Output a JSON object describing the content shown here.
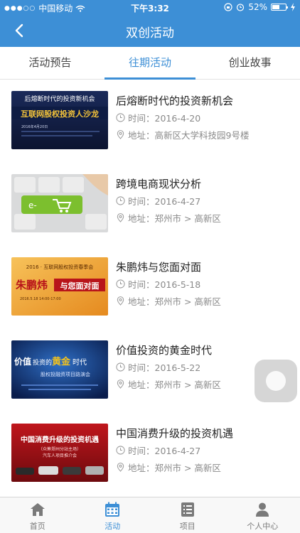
{
  "status_bar": {
    "carrier": "中国移动",
    "time": "下午3:32",
    "battery": "52%"
  },
  "nav": {
    "title": "双创活动"
  },
  "tabs": [
    {
      "label": "活动预告"
    },
    {
      "label": "往期活动"
    },
    {
      "label": "创业故事"
    }
  ],
  "activities": [
    {
      "title": "后熔断时代的投资新机会",
      "time": "时间：2016-4-20",
      "location": "地址：高新区大学科技园9号楼",
      "poster": {
        "line1": "后熔断时代的投资新机会",
        "line2": "互联网股权投资人沙龙",
        "line3": "2016年4月20日"
      }
    },
    {
      "title": "跨境电商现状分析",
      "time": "时间：2016-4-27",
      "location": "地址：郑州市 > 高新区",
      "poster": {
        "key": "e-"
      }
    },
    {
      "title": "朱鹏炜与您面对面",
      "time": "时间：2016-5-18",
      "location": "地址：郑州市 > 高新区",
      "poster": {
        "line1": "2016 · 互联网股权投资春季会",
        "line2": "朱鹏炜",
        "line3": "与您面对面",
        "line4": "2016.5.18 14:00-17:00"
      }
    },
    {
      "title": "价值投资的黄金时代",
      "time": "时间：2016-5-22",
      "location": "地址：郑州市 > 高新区",
      "poster": {
        "line1a": "价值",
        "line1b": "投资的",
        "line1c": "黄金",
        "line1d": "时代",
        "line2": "股权投融资项目路演会"
      }
    },
    {
      "title": "中国消费升级的投资机遇",
      "time": "时间：2016-4-27",
      "location": "地址：郑州市 > 高新区",
      "poster": {
        "line1": "中国消费升级的投资机遇",
        "line2": "（众筹郑州分站主场）",
        "line3": "汽车人项目推介会"
      }
    }
  ],
  "tab_bar": [
    {
      "label": "首页",
      "icon": "home-icon"
    },
    {
      "label": "活动",
      "icon": "calendar-icon"
    },
    {
      "label": "项目",
      "icon": "list-icon"
    },
    {
      "label": "个人中心",
      "icon": "person-icon"
    }
  ],
  "colors": {
    "brand": "#3d8fd6",
    "tab_inactive": "#7a7a7a",
    "meta_text": "#8a8a8a"
  }
}
